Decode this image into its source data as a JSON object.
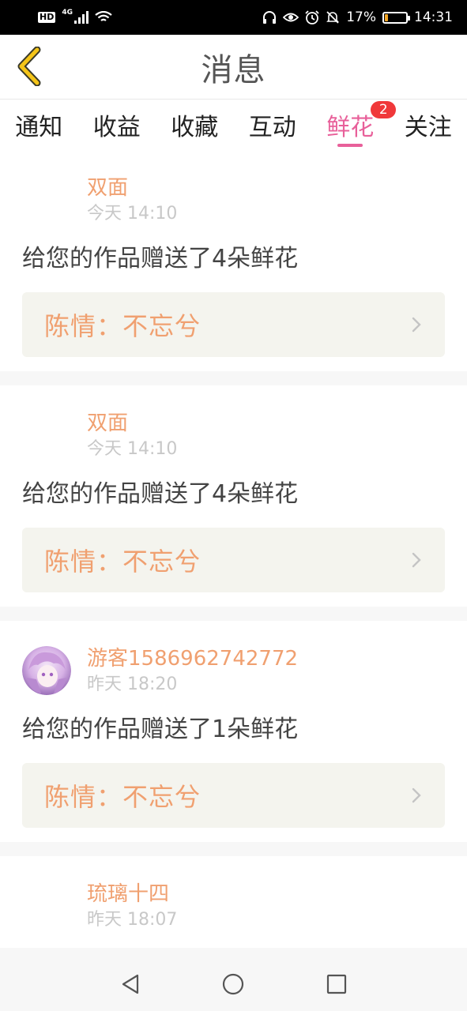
{
  "status_bar": {
    "hd": "HD",
    "network": "4G",
    "battery_text": "17%",
    "battery_level": 0.17,
    "time": "14:31"
  },
  "header": {
    "title": "消息",
    "back_icon": "chevron-left-icon"
  },
  "tabs": [
    {
      "label": "通知",
      "active": false
    },
    {
      "label": "收益",
      "active": false
    },
    {
      "label": "收藏",
      "active": false
    },
    {
      "label": "互动",
      "active": false
    },
    {
      "label": "鲜花",
      "active": true,
      "badge": "2"
    },
    {
      "label": "关注",
      "active": false
    }
  ],
  "items": [
    {
      "user": "双面",
      "time": "今天 14:10",
      "message": "给您的作品赠送了4朵鲜花",
      "work": "陈情：不忘兮",
      "has_avatar": false
    },
    {
      "user": "双面",
      "time": "今天 14:10",
      "message": "给您的作品赠送了4朵鲜花",
      "work": "陈情：不忘兮",
      "has_avatar": false
    },
    {
      "user": "游客1586962742772",
      "time": "昨天 18:20",
      "message": "给您的作品赠送了1朵鲜花",
      "work": "陈情：不忘兮",
      "has_avatar": true
    },
    {
      "user": "琉璃十四",
      "time": "昨天 18:07",
      "message": "",
      "work": "",
      "has_avatar": false
    }
  ],
  "colors": {
    "accent": "#e8609a",
    "name": "#f0a070",
    "badge": "#f0383a",
    "back": "#f5c518"
  }
}
